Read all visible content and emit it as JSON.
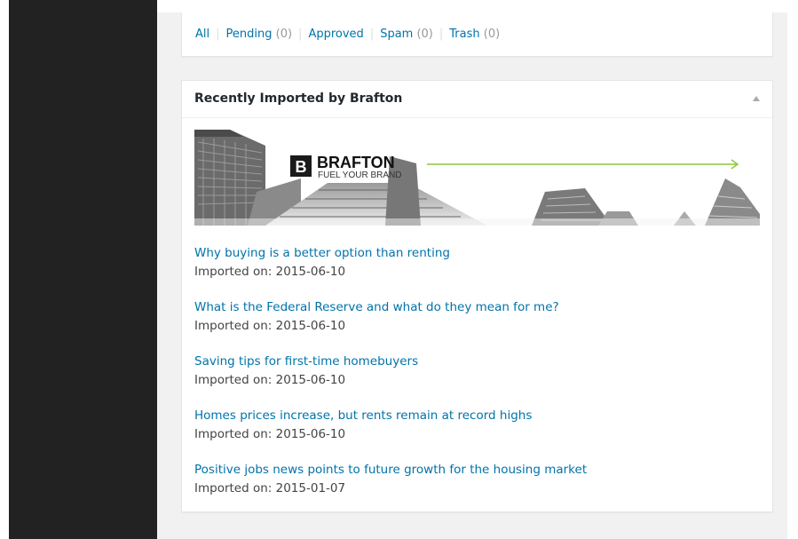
{
  "comment_filters": {
    "all": "All",
    "pending": "Pending",
    "pending_count": "(0)",
    "approved": "Approved",
    "spam": "Spam",
    "spam_count": "(0)",
    "trash": "Trash",
    "trash_count": "(0)"
  },
  "widget": {
    "title": "Recently Imported by Brafton",
    "toggle_icon": "triangle-up-icon"
  },
  "banner": {
    "logo_letter": "B",
    "brand_name": "BRAFTON",
    "tagline": "FUEL YOUR BRAND",
    "arrow_color": "#8cc63f"
  },
  "imports": [
    {
      "title": "Why buying is a better option than renting",
      "date": "Imported on: 2015-06-10"
    },
    {
      "title": "What is the Federal Reserve and what do they mean for me?",
      "date": "Imported on: 2015-06-10"
    },
    {
      "title": "Saving tips for first-time homebuyers",
      "date": "Imported on: 2015-06-10"
    },
    {
      "title": "Homes prices increase, but rents remain at record highs",
      "date": "Imported on: 2015-06-10"
    },
    {
      "title": "Positive jobs news points to future growth for the housing market",
      "date": "Imported on: 2015-01-07"
    }
  ],
  "colors": {
    "link": "#0073aa",
    "admin_menu": "#222222",
    "background": "#f1f1f1"
  }
}
